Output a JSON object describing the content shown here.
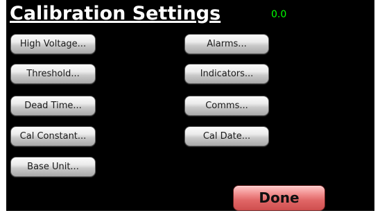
{
  "header": {
    "title": "Calibration Settings",
    "readout": "0.0"
  },
  "buttons": {
    "high_voltage": "High Voltage...",
    "threshold": "Threshold...",
    "dead_time": "Dead Time...",
    "cal_constant": "Cal Constant...",
    "base_unit": "Base Unit...",
    "alarms": "Alarms...",
    "indicators": "Indicators...",
    "comms": "Comms...",
    "cal_date": "Cal Date...",
    "done": "Done"
  },
  "colors": {
    "background": "#000000",
    "title": "#ffffff",
    "readout": "#00ff00",
    "done_button": "#e06666",
    "button": "#d9d9d9"
  }
}
